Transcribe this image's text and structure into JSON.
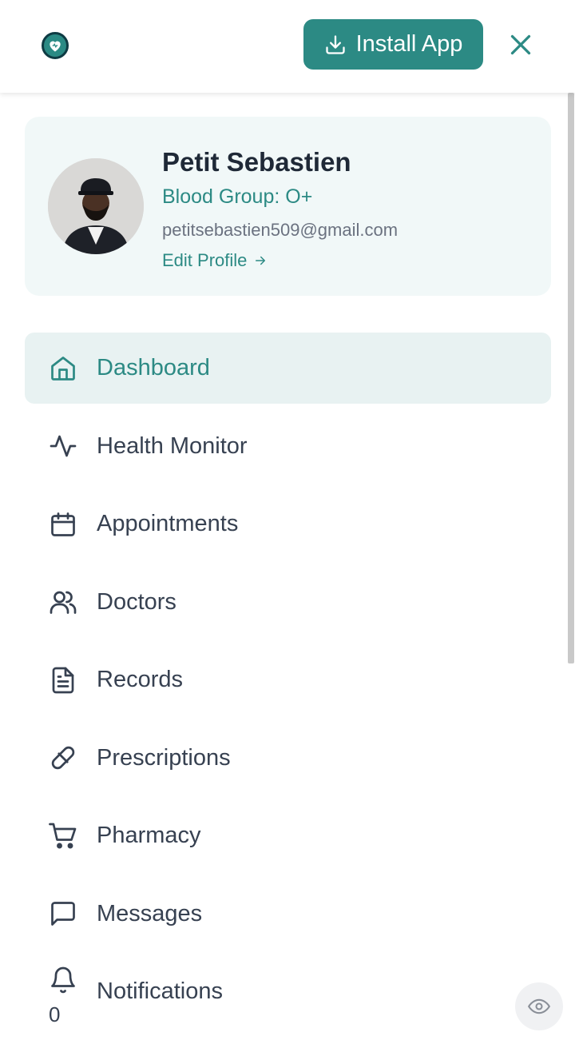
{
  "header": {
    "install_label": "Install App"
  },
  "profile": {
    "name": "Petit Sebastien",
    "blood_group": "Blood Group: O+",
    "email": "petitsebastien509@gmail.com",
    "edit_label": "Edit Profile"
  },
  "nav": {
    "items": [
      {
        "label": "Dashboard",
        "icon": "home-icon",
        "active": true
      },
      {
        "label": "Health Monitor",
        "icon": "activity-icon"
      },
      {
        "label": "Appointments",
        "icon": "calendar-icon"
      },
      {
        "label": "Doctors",
        "icon": "users-icon"
      },
      {
        "label": "Records",
        "icon": "file-text-icon"
      },
      {
        "label": "Prescriptions",
        "icon": "pill-icon"
      },
      {
        "label": "Pharmacy",
        "icon": "cart-icon"
      },
      {
        "label": "Messages",
        "icon": "message-icon"
      },
      {
        "label": "Notifications",
        "icon": "bell-icon",
        "count": "0"
      }
    ]
  },
  "colors": {
    "accent": "#2c8a84",
    "active_bg": "#e8f2f2",
    "card_bg": "#f1f8f8"
  }
}
